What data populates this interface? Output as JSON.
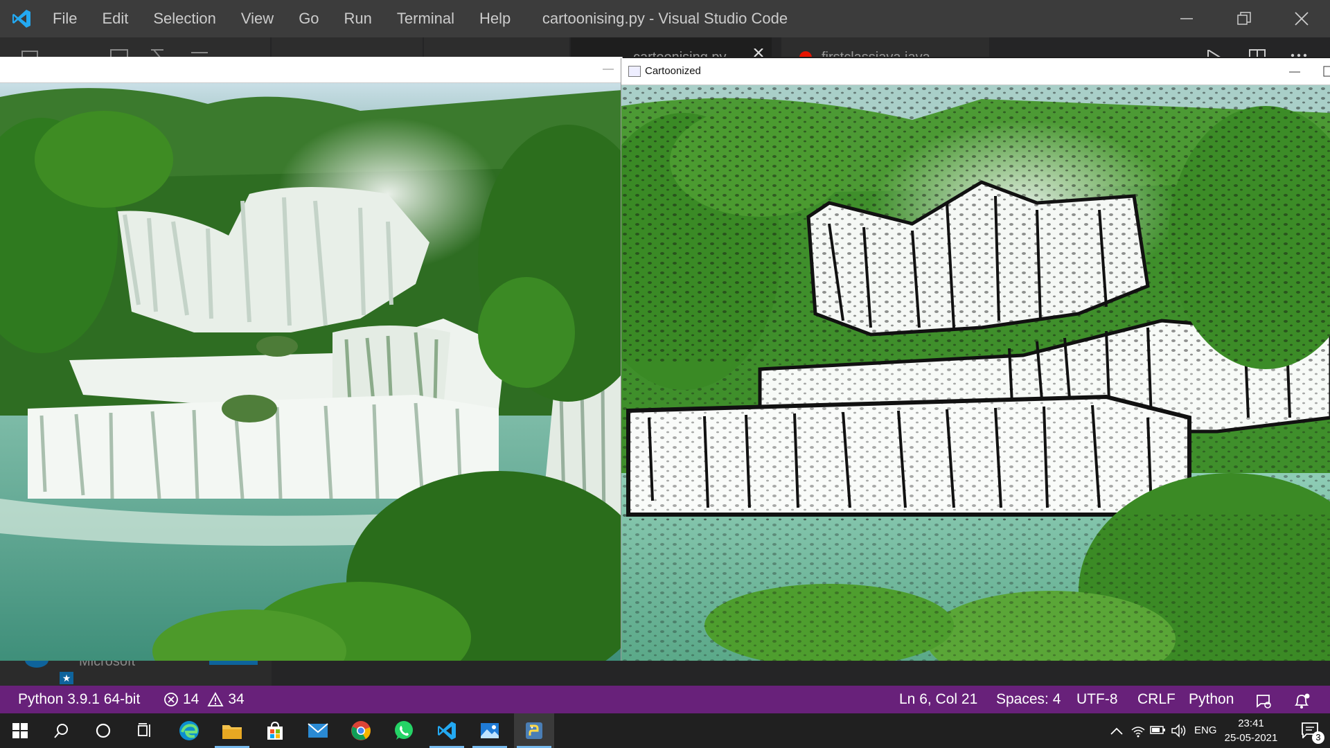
{
  "vscode": {
    "menu": [
      "File",
      "Edit",
      "Selection",
      "View",
      "Go",
      "Run",
      "Terminal",
      "Help"
    ],
    "window_title": "cartoonising.py - Visual Studio Code",
    "tabs": [
      "cartoonising.py",
      "firstclassjava.java"
    ]
  },
  "windows": {
    "cartoon_title": "Cartoonized"
  },
  "panel": {
    "text": "Microsoft"
  },
  "statusbar": {
    "interpreter": "Python 3.9.1 64-bit",
    "errors": "14",
    "warnings": "34",
    "cursor": "Ln 6, Col 21",
    "indent": "Spaces: 4",
    "encoding": "UTF-8",
    "eol": "CRLF",
    "language": "Python",
    "notification_count": "3"
  },
  "taskbar": {
    "language": "ENG",
    "time": "23:41",
    "date": "25-05-2021",
    "notification_badge": "3"
  }
}
